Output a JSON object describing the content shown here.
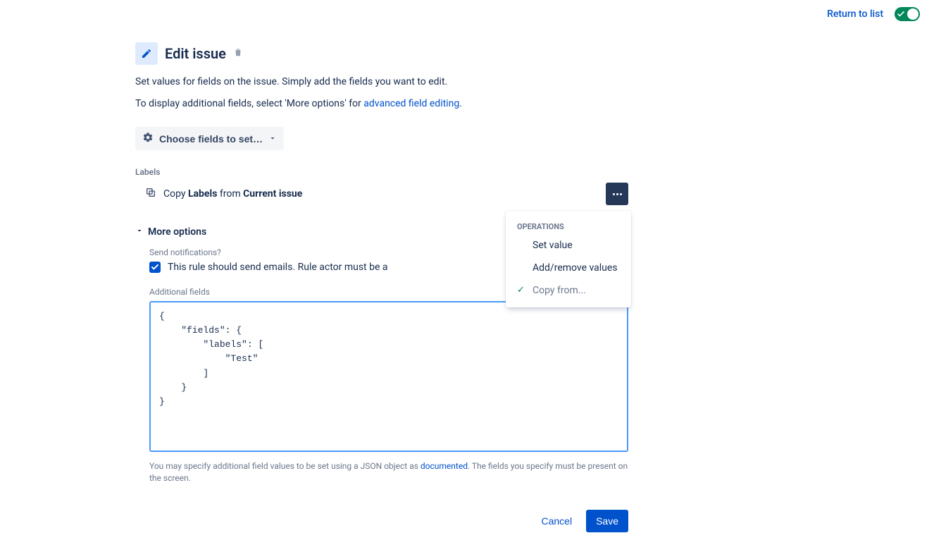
{
  "topbar": {
    "return_link": "Return to list"
  },
  "header": {
    "title": "Edit issue"
  },
  "description": {
    "line1": "Set values for fields on the issue. Simply add the fields you want to edit.",
    "line2_prefix": "To display additional fields, select 'More options' for ",
    "line2_link": "advanced field editing",
    "line2_suffix": "."
  },
  "choose_fields_btn": "Choose fields to set…",
  "labels": {
    "section": "Labels",
    "copy_prefix": "Copy ",
    "copy_field": "Labels",
    "copy_mid": " from ",
    "copy_source": "Current issue"
  },
  "dropdown": {
    "heading": "OPERATIONS",
    "items": [
      {
        "label": "Set value",
        "selected": false
      },
      {
        "label": "Add/remove values",
        "selected": false
      },
      {
        "label": "Copy from...",
        "selected": true
      }
    ]
  },
  "more_options_label": "More options",
  "notifications": {
    "label": "Send notifications?",
    "checkbox_text": "This rule should send emails. Rule actor must be a"
  },
  "additional_fields": {
    "label": "Additional fields",
    "code": "{\n    \"fields\": {\n        \"labels\": [\n            \"Test\"\n        ]\n    }\n}",
    "helper_prefix": "You may specify additional field values to be set using a JSON object as ",
    "helper_link": "documented",
    "helper_suffix": ". The fields you specify must be present on the screen."
  },
  "footer": {
    "cancel": "Cancel",
    "save": "Save"
  }
}
